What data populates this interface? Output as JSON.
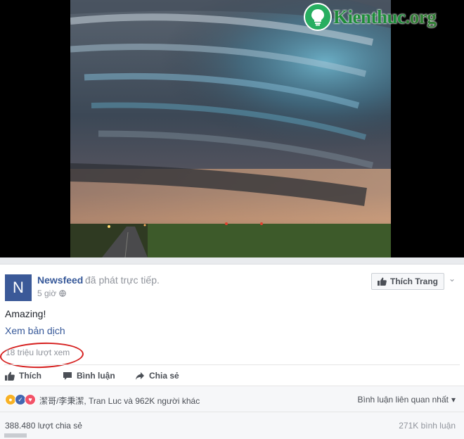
{
  "watermark": {
    "part1": "Kienthuc",
    "part2": ".org"
  },
  "post": {
    "avatar_letter": "N",
    "page_name": "Newsfeed",
    "action_text": "đã phát trực tiếp.",
    "time": "5 giờ",
    "like_page_label": "Thích Trang",
    "text": "Amazing!",
    "translate_link": "Xem bản dịch",
    "views": "18 triệu lượt xem",
    "actions": {
      "like": "Thích",
      "comment": "Bình luận",
      "share": "Chia sẻ"
    },
    "reactions_text": "潔哥/李秉潔, Tran Luc và 962K người khác",
    "sort_comments": "Bình luận liên quan nhất",
    "shares": "388.480 lượt chia sẻ",
    "comments_count": "271K bình luận"
  },
  "colors": {
    "link": "#365899",
    "brand": "#3b5998",
    "annotation_circle": "#d6201f"
  }
}
